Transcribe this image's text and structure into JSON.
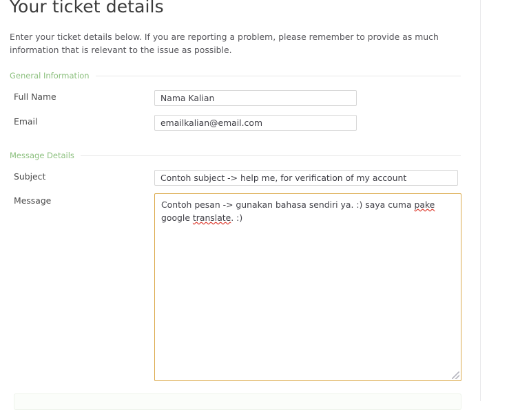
{
  "page": {
    "title": "Your ticket details",
    "intro": "Enter your ticket details below. If you are reporting a problem, please remember to provide as much information that is relevant to the issue as possible."
  },
  "sections": [
    {
      "id": "general",
      "legend": "General Information"
    },
    {
      "id": "message",
      "legend": "Message Details"
    }
  ],
  "fields": {
    "full_name": {
      "label": "Full Name",
      "value": "Nama Kalian",
      "placeholder": "Full Name"
    },
    "email": {
      "label": "Email",
      "value": "emailkalian@email.com",
      "placeholder": "Email"
    },
    "subject": {
      "label": "Subject",
      "value": "Contoh subject -> help me, for verification of my account",
      "placeholder": "Subject"
    },
    "message": {
      "label": "Message",
      "placeholder": "Message",
      "value_part_1": "Contoh pesan -> gunakan bahasa sendiri ya. :) saya cuma ",
      "value_misspelled_1": "pake",
      "value_part_2": " google ",
      "value_misspelled_2": "translate",
      "value_part_3": ". :)",
      "value_full": "Contoh pesan -> gunakan bahasa sendiri ya. :) saya cuma pake google translate. :)"
    }
  },
  "colors": {
    "legend_green": "#8cc07e",
    "focus_border_orange": "#dba94a",
    "input_border": "#d7d7d7",
    "text": "#444444",
    "title": "#3b3b3b",
    "spellcheck_underline": "#e04a3f"
  }
}
